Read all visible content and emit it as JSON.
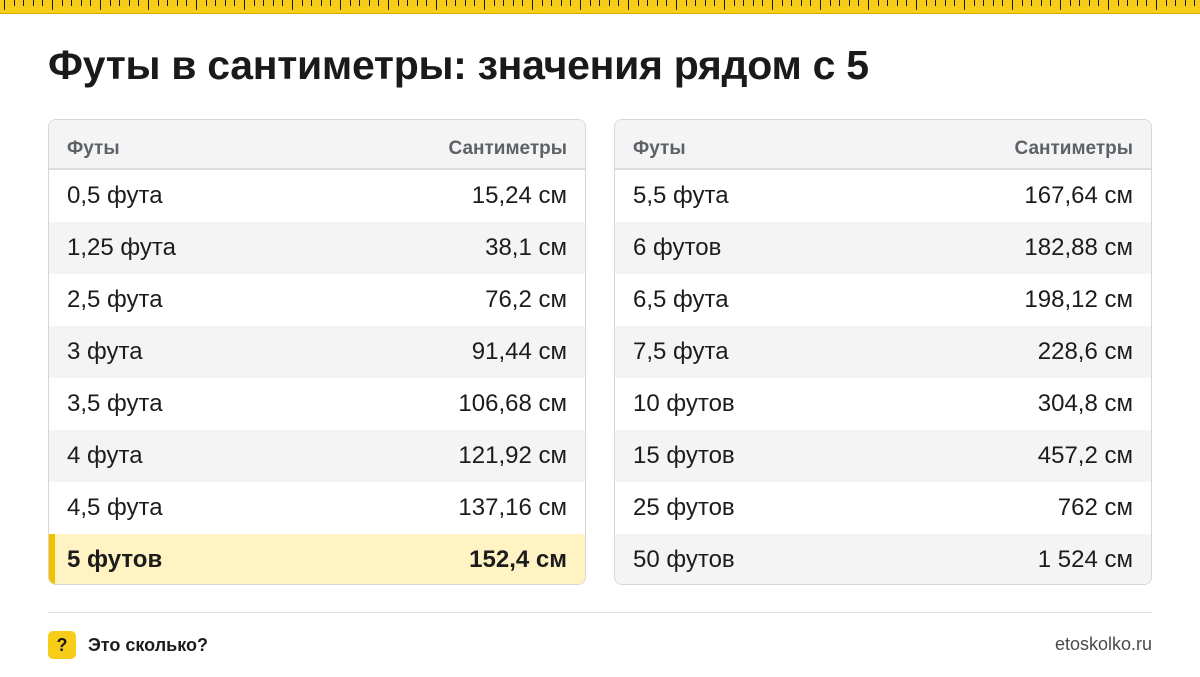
{
  "title": "Футы в сантиметры: значения рядом с 5",
  "accent_color": "#f7cd1a",
  "highlight_color": "#fff3c4",
  "header": {
    "feet": "Футы",
    "cm": "Сантиметры"
  },
  "left_rows": [
    {
      "feet": "0,5 фута",
      "cm": "15,24 см"
    },
    {
      "feet": "1,25 фута",
      "cm": "38,1 см"
    },
    {
      "feet": "2,5 фута",
      "cm": "76,2 см"
    },
    {
      "feet": "3 фута",
      "cm": "91,44 см"
    },
    {
      "feet": "3,5 фута",
      "cm": "106,68 см"
    },
    {
      "feet": "4 фута",
      "cm": "121,92 см"
    },
    {
      "feet": "4,5 фута",
      "cm": "137,16 см"
    },
    {
      "feet": "5 футов",
      "cm": "152,4 см",
      "highlighted": true
    }
  ],
  "right_rows": [
    {
      "feet": "5,5 фута",
      "cm": "167,64 см"
    },
    {
      "feet": "6 футов",
      "cm": "182,88 см"
    },
    {
      "feet": "6,5 фута",
      "cm": "198,12 см"
    },
    {
      "feet": "7,5 фута",
      "cm": "228,6 см"
    },
    {
      "feet": "10 футов",
      "cm": "304,8 см"
    },
    {
      "feet": "15 футов",
      "cm": "457,2 см"
    },
    {
      "feet": "25 футов",
      "cm": "762 см"
    },
    {
      "feet": "50 футов",
      "cm": "1 524 см"
    }
  ],
  "footer": {
    "icon": "question-mark-icon",
    "icon_glyph": "?",
    "brand": "Это сколько?",
    "site": "etoskolko.ru"
  }
}
